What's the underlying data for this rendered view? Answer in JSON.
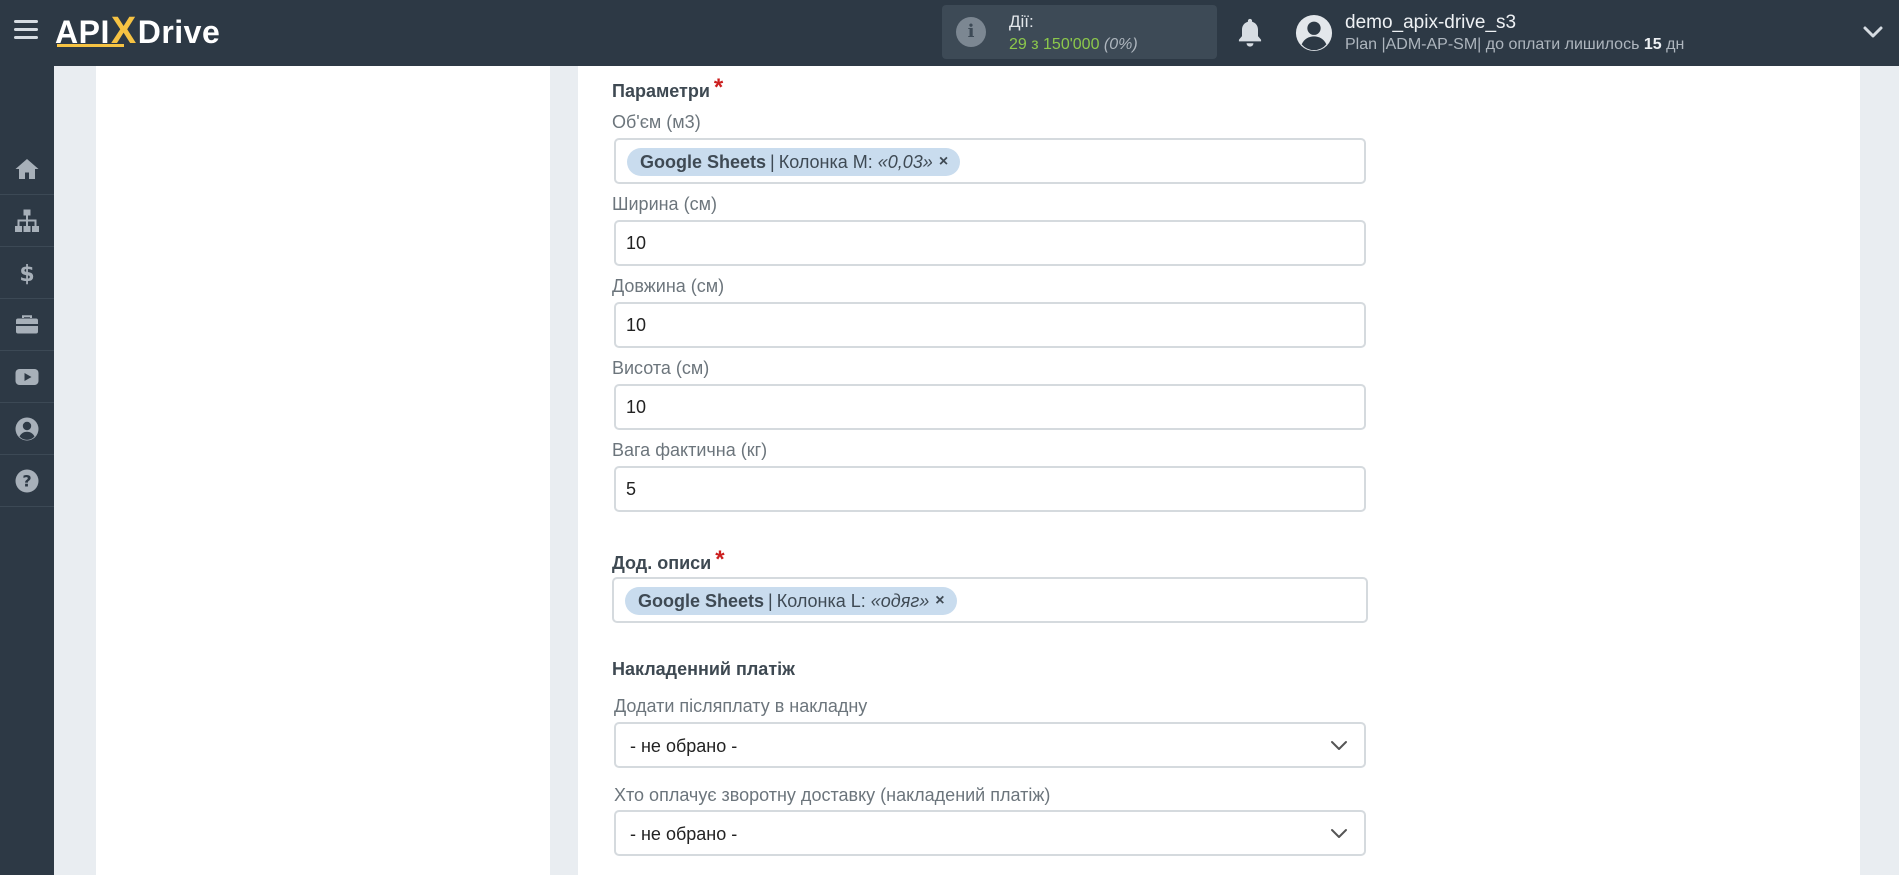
{
  "header": {
    "logo_left": "API",
    "logo_x": "X",
    "logo_right": "Drive",
    "actions_label": "Дії:",
    "actions_value": "29 з 150'000",
    "actions_percent": "(0%)",
    "username": "demo_apix-drive_s3",
    "plan_prefix": "Plan |ADM-AP-SM| до оплати лишилось",
    "plan_days": "15",
    "plan_suffix": "дн"
  },
  "sidebar": {
    "items": [
      {
        "icon": "home-icon"
      },
      {
        "icon": "sitemap-icon"
      },
      {
        "icon": "dollar-icon"
      },
      {
        "icon": "briefcase-icon"
      },
      {
        "icon": "youtube-icon"
      },
      {
        "icon": "user-circle-icon"
      },
      {
        "icon": "question-circle-icon"
      }
    ]
  },
  "form": {
    "params_title": "Параметри",
    "required_mark": "*",
    "volume": {
      "label": "Об'єм (м3)",
      "chip_source": "Google Sheets",
      "chip_sep": "|",
      "chip_column": "Колонка M:",
      "chip_value": "«0,03»",
      "chip_remove": "×"
    },
    "width": {
      "label": "Ширина (см)",
      "value": "10"
    },
    "length": {
      "label": "Довжина (см)",
      "value": "10"
    },
    "height": {
      "label": "Висота (см)",
      "value": "10"
    },
    "weight": {
      "label": "Вага фактична (кг)",
      "value": "5"
    },
    "desc_title": "Дод. описи",
    "description": {
      "chip_source": "Google Sheets",
      "chip_sep": "|",
      "chip_column": "Колонка L:",
      "chip_value": "«одяг»",
      "chip_remove": "×"
    },
    "cod_title": "Накладенний платіж",
    "add_cod": {
      "label": "Додати післяплату в накладну",
      "value": "- не обрано -"
    },
    "who_pays": {
      "label": "Хто оплачує зворотну доставку (накладений платіж)",
      "value": "- не обрано -"
    }
  },
  "colors": {
    "header_bg": "#2d3945",
    "accent_yellow": "#f6c343",
    "actions_green": "#8cc84b",
    "chip_bg": "#c9dcee",
    "required_red": "#cc1f1f"
  }
}
